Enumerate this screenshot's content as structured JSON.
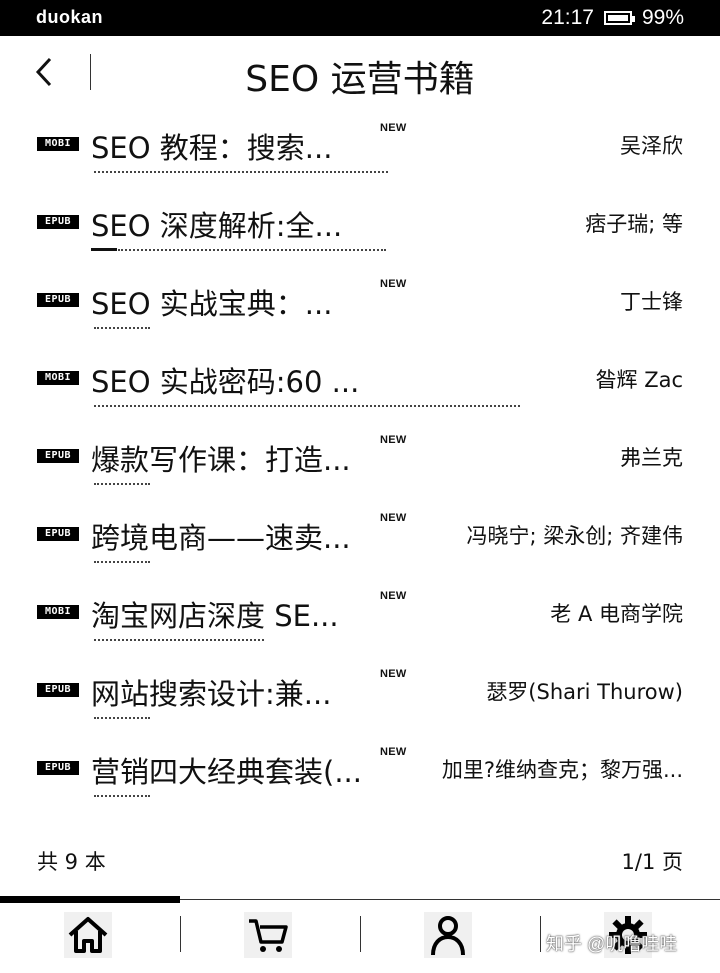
{
  "status": {
    "brand": "duokan",
    "time": "21:17",
    "battery": "99%",
    "battery_level": 0.99
  },
  "header": {
    "title": "SEO 运营书籍",
    "back_icon": "chevron-left-icon"
  },
  "books": [
    {
      "format": "MOBI",
      "title": "SEO 教程：搜索...",
      "new_label": "NEW",
      "author": "吴泽欣"
    },
    {
      "format": "EPUB",
      "title": "SEO 深度解析:全...",
      "new_label": "",
      "author": "痞子瑞; 等"
    },
    {
      "format": "EPUB",
      "title": "SEO 实战宝典：...",
      "new_label": "NEW",
      "author": "丁士锋"
    },
    {
      "format": "MOBI",
      "title": "SEO 实战密码:60 ...",
      "new_label": "",
      "author": "昝辉 Zac"
    },
    {
      "format": "EPUB",
      "title": "爆款写作课：打造...",
      "new_label": "NEW",
      "author": "弗兰克"
    },
    {
      "format": "EPUB",
      "title": "跨境电商——速卖...",
      "new_label": "NEW",
      "author": "冯晓宁; 梁永创; 齐建伟"
    },
    {
      "format": "MOBI",
      "title": "淘宝网店深度 SE...",
      "new_label": "NEW",
      "author": "老 A 电商学院"
    },
    {
      "format": "EPUB",
      "title": "网站搜索设计:兼...",
      "new_label": "NEW",
      "author": "瑟罗(Shari Thurow)"
    },
    {
      "format": "EPUB",
      "title": "营销四大经典套装(...",
      "new_label": "NEW",
      "author": "加里?维纳查克；黎万强..."
    }
  ],
  "summary": {
    "total": "共 9 本",
    "page": "1/1 页"
  },
  "tabs": [
    {
      "name": "home",
      "icon": "home-icon",
      "active": true
    },
    {
      "name": "store",
      "icon": "cart-icon",
      "active": false
    },
    {
      "name": "profile",
      "icon": "user-icon",
      "active": false
    },
    {
      "name": "settings",
      "icon": "gear-icon",
      "active": false
    }
  ],
  "watermark": "知乎 @叽噜哇哇"
}
